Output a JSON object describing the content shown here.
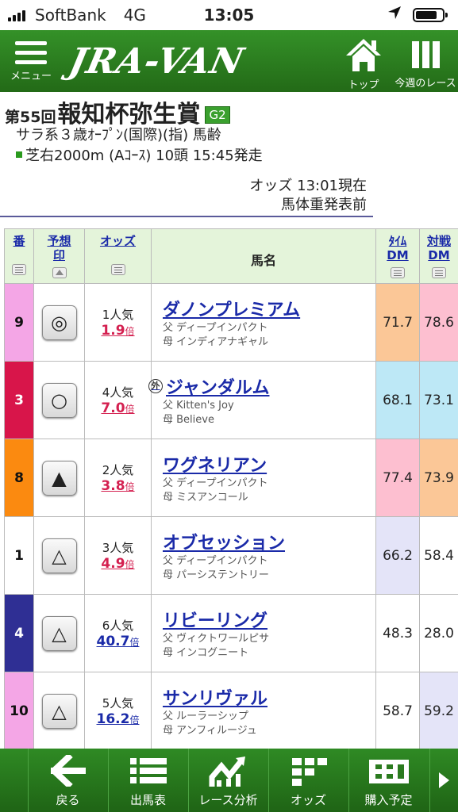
{
  "status_bar": {
    "carrier": "SoftBank",
    "network": "4G",
    "time": "13:05"
  },
  "header": {
    "menu_label": "メニュー",
    "logo": "JRA-VAN",
    "top_label": "トップ",
    "week_label": "今週のレース"
  },
  "race": {
    "number": "第55回",
    "name": "報知杯弥生賞",
    "grade": "G2",
    "conditions": "サラ系３歳ｵｰﾌﾟﾝ(国際)(指) 馬齢",
    "course": "芝右2000m (Aｺｰｽ) 10頭 15:45発走",
    "odds_time": "オッズ 13:01現在",
    "weight_status": "馬体重発表前"
  },
  "table": {
    "headers": {
      "umaban": "番",
      "mark_l1": "予想",
      "mark_l2": "印",
      "odds": "オッズ",
      "horse": "馬名",
      "time_l1": "ﾀｲﾑ",
      "time_l2": "DM",
      "taisen_l1": "対戦",
      "taisen_l2": "DM"
    },
    "rows": [
      {
        "umaban": "9",
        "frame_color": "#f4a6e6",
        "mark": "◎",
        "popularity": "1人気",
        "odds": "1.9",
        "odds_unit": "倍",
        "name": "ダノンプレミアム",
        "foreign": "",
        "sire": "父 ディープインパクト",
        "dam": "母 インディアナギャル",
        "time_dm": "71.7",
        "time_dm_color": "#fbc797",
        "taisen_dm": "78.6",
        "taisen_dm_color": "#fdbfd0"
      },
      {
        "umaban": "3",
        "frame_color": "#d8154a",
        "mark": "○",
        "popularity": "4人気",
        "odds": "7.0",
        "odds_unit": "倍",
        "name": "ジャンダルム",
        "foreign": "外",
        "sire": "父 Kitten's Joy",
        "dam": "母 Believe",
        "time_dm": "68.1",
        "time_dm_color": "#bde8f6",
        "taisen_dm": "73.1",
        "taisen_dm_color": "#bde8f6"
      },
      {
        "umaban": "8",
        "frame_color": "#fb8a10",
        "mark": "▲",
        "popularity": "2人気",
        "odds": "3.8",
        "odds_unit": "倍",
        "name": "ワグネリアン",
        "foreign": "",
        "sire": "父 ディープインパクト",
        "dam": "母 ミスアンコール",
        "time_dm": "77.4",
        "time_dm_color": "#fdbfd0",
        "taisen_dm": "73.9",
        "taisen_dm_color": "#fbc797"
      },
      {
        "umaban": "1",
        "frame_color": "#ffffff",
        "mark": "△",
        "popularity": "3人気",
        "odds": "4.9",
        "odds_unit": "倍",
        "name": "オブセッション",
        "foreign": "",
        "sire": "父 ディープインパクト",
        "dam": "母 パーシステントリー",
        "time_dm": "66.2",
        "time_dm_color": "#e4e4f8",
        "taisen_dm": "58.4",
        "taisen_dm_color": "#ffffff"
      },
      {
        "umaban": "4",
        "frame_color": "#2f2f94",
        "mark": "△",
        "popularity": "6人気",
        "odds": "40.7",
        "odds_unit": "倍",
        "name": "リビーリング",
        "foreign": "",
        "sire": "父 ヴィクトワールピサ",
        "dam": "母 インコグニート",
        "time_dm": "48.3",
        "time_dm_color": "#ffffff",
        "taisen_dm": "28.0",
        "taisen_dm_color": "#ffffff"
      },
      {
        "umaban": "10",
        "frame_color": "#f4a6e6",
        "mark": "△",
        "popularity": "5人気",
        "odds": "16.2",
        "odds_unit": "倍",
        "name": "サンリヴァル",
        "foreign": "",
        "sire": "父 ルーラーシップ",
        "dam": "母 アンフィルージュ",
        "time_dm": "58.7",
        "time_dm_color": "#ffffff",
        "taisen_dm": "59.2",
        "taisen_dm_color": "#e4e4f8"
      }
    ]
  },
  "bottom_nav": [
    {
      "label": "戻る",
      "icon": "back-arrow-icon"
    },
    {
      "label": "出馬表",
      "icon": "list-icon"
    },
    {
      "label": "レース分析",
      "icon": "analysis-icon"
    },
    {
      "label": "オッズ",
      "icon": "odds-icon"
    },
    {
      "label": "購入予定",
      "icon": "ticket-icon"
    }
  ]
}
